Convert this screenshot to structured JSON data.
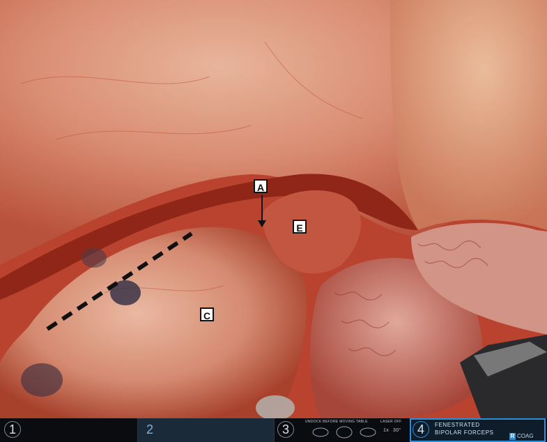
{
  "annotations": {
    "a": "A",
    "c": "C",
    "e": "E"
  },
  "instrument_bar": {
    "slot1": {
      "number": "1"
    },
    "slot2": {
      "number": "2"
    },
    "slot3": {
      "number": "3",
      "top_text": "UNDOCK BEFORE MOVING TABLE",
      "laser_text": "LASER OFF",
      "zoom_text": "1x",
      "angle_text": "30°"
    },
    "slot4": {
      "number": "4",
      "instrument_line1": "FENESTRATED",
      "instrument_line2": "BIPOLAR FORCEPS",
      "mode_badge": "R",
      "mode_label": "COAG"
    }
  },
  "colors": {
    "tissue_base": "#b9432e",
    "bar_background": "#0a0c0f",
    "slot2_tint": "#1b2a38",
    "slot4_border": "#2d8fd8",
    "coag_badge": "#2d8fd8"
  }
}
